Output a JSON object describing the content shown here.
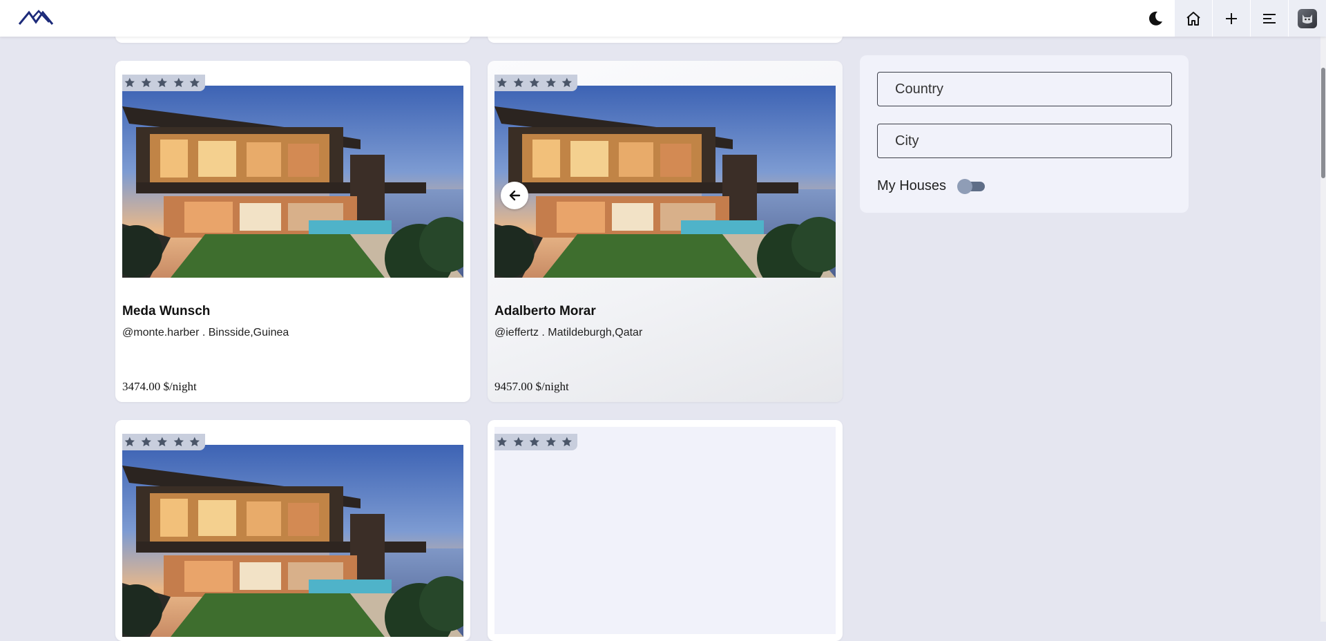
{
  "header": {
    "logo_icon": "mountain-logo-icon",
    "buttons": [
      {
        "icon": "moon-icon"
      },
      {
        "icon": "home-icon"
      },
      {
        "icon": "plus-icon"
      },
      {
        "icon": "menu-icon"
      },
      {
        "icon": "avatar"
      }
    ]
  },
  "listings": [
    {
      "name": "Meda Wunsch",
      "subtitle": "@monte.harber . Binsside,Guinea",
      "price": "3474.00 $/night",
      "rating": 5
    },
    {
      "name": "Adalberto Morar",
      "subtitle": "@ieffertz . Matildeburgh,Qatar",
      "price": "9457.00 $/night",
      "rating": 5
    },
    {
      "name": "",
      "subtitle": "",
      "price": "",
      "rating": 5
    },
    {
      "name": "",
      "subtitle": "",
      "price": "",
      "rating": 5
    }
  ],
  "filters": {
    "country_placeholder": "Country",
    "city_placeholder": "City",
    "my_houses_label": "My Houses",
    "my_houses_enabled": false
  },
  "colors": {
    "background": "#e5e6f0",
    "panel": "#f1f2fa",
    "star": "#4a5568",
    "logo": "#1d2b7a"
  }
}
